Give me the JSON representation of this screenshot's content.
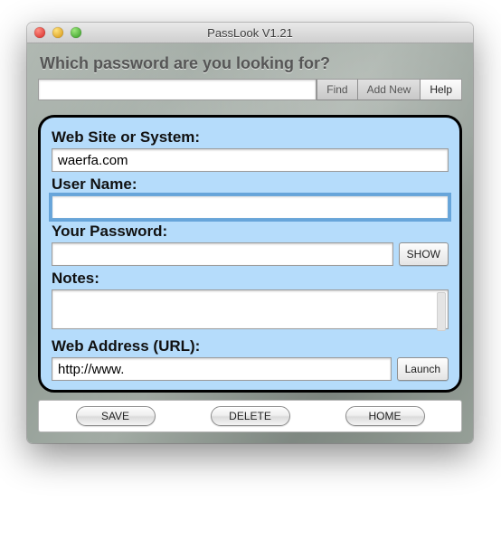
{
  "window": {
    "title": "PassLook V1.21"
  },
  "heading": "Which password are you looking for?",
  "search": {
    "value": "",
    "find_label": "Find",
    "addnew_label": "Add New",
    "help_label": "Help"
  },
  "form": {
    "website_label": "Web Site or System:",
    "website_value": "waerfa.com",
    "username_label": "User Name:",
    "username_value": "",
    "password_label": "Your Password:",
    "password_value": "",
    "show_label": "SHOW",
    "notes_label": "Notes:",
    "notes_value": "",
    "url_label": "Web Address (URL):",
    "url_value": "http://www.",
    "launch_label": "Launch"
  },
  "actions": {
    "save": "SAVE",
    "delete": "DELETE",
    "home": "HOME"
  }
}
